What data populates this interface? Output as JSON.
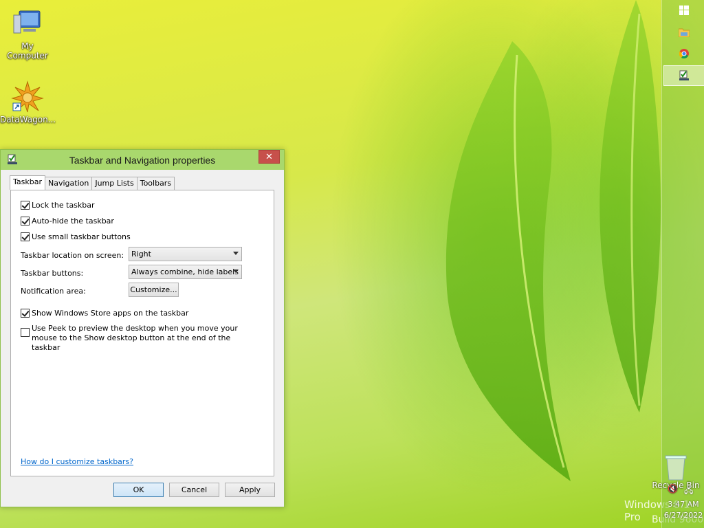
{
  "desktop": {
    "icons": [
      {
        "label": "My Computer"
      },
      {
        "label": "DataWagon..."
      }
    ],
    "recycle_bin_label": "Recycle Bin"
  },
  "watermark": {
    "line1": "Windows 8.1 Pro",
    "line2": "Build 9600"
  },
  "taskbar": {
    "buttons": [
      "start-button",
      "file-explorer",
      "chrome",
      "taskbar-properties"
    ],
    "clock_time": "3:47 AM",
    "clock_date": "6/27/2022"
  },
  "dialog": {
    "title": "Taskbar and Navigation properties",
    "close_label": "✕",
    "tabs": [
      {
        "label": "Taskbar",
        "active": true
      },
      {
        "label": "Navigation",
        "active": false
      },
      {
        "label": "Jump Lists",
        "active": false
      },
      {
        "label": "Toolbars",
        "active": false
      }
    ],
    "checkboxes": {
      "lock": {
        "label": "Lock the taskbar",
        "checked": true
      },
      "autohide": {
        "label": "Auto-hide the taskbar",
        "checked": true
      },
      "small": {
        "label": "Use small taskbar buttons",
        "checked": true
      },
      "store_apps": {
        "label": "Show Windows Store apps on the taskbar",
        "checked": true
      },
      "peek": {
        "label": "Use Peek to preview the desktop when you move your mouse to the Show desktop button at the end of the taskbar",
        "checked": false
      }
    },
    "location": {
      "label": "Taskbar location on screen:",
      "value": "Right"
    },
    "buttons_combine": {
      "label": "Taskbar buttons:",
      "value": "Always combine, hide labels"
    },
    "notification": {
      "label": "Notification area:",
      "button": "Customize..."
    },
    "help_link": "How do I customize taskbars?",
    "footer": {
      "ok": "OK",
      "cancel": "Cancel",
      "apply": "Apply"
    }
  }
}
